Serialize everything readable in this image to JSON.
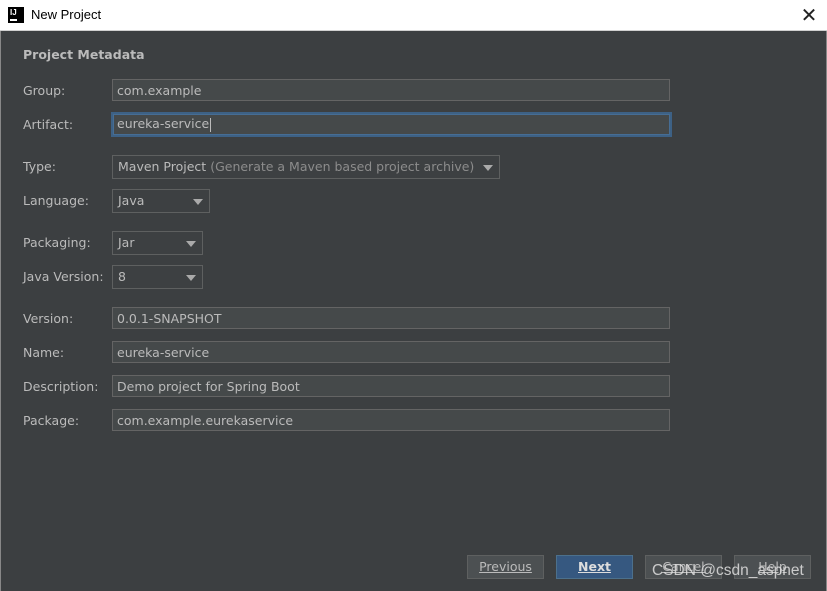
{
  "window": {
    "title": "New Project",
    "app_icon_text": "IJ"
  },
  "section_title": "Project Metadata",
  "fields": {
    "group": {
      "label": "Group:",
      "value": "com.example"
    },
    "artifact": {
      "label": "Artifact:",
      "value": "eureka-service"
    },
    "type": {
      "label": "Type:",
      "value": "Maven Project",
      "hint": "(Generate a Maven based project archive)"
    },
    "language": {
      "label": "Language:",
      "value": "Java"
    },
    "packaging": {
      "label": "Packaging:",
      "value": "Jar"
    },
    "java_version": {
      "label": "Java Version:",
      "value": "8"
    },
    "version": {
      "label": "Version:",
      "value": "0.0.1-SNAPSHOT"
    },
    "name": {
      "label": "Name:",
      "value": "eureka-service"
    },
    "description": {
      "label": "Description:",
      "value": "Demo project for Spring Boot"
    },
    "package": {
      "label": "Package:",
      "value": "com.example.eurekaservice"
    }
  },
  "buttons": {
    "previous": "Previous",
    "next": "Next",
    "cancel": "Cancel",
    "help": "Help"
  },
  "watermark": "CSDN @csdn_aspnet",
  "colors": {
    "background": "#3c3f41",
    "field_background": "#45494a",
    "text": "#bbbbbb",
    "default_button": "#365880",
    "focus_border": "#3d6185"
  }
}
